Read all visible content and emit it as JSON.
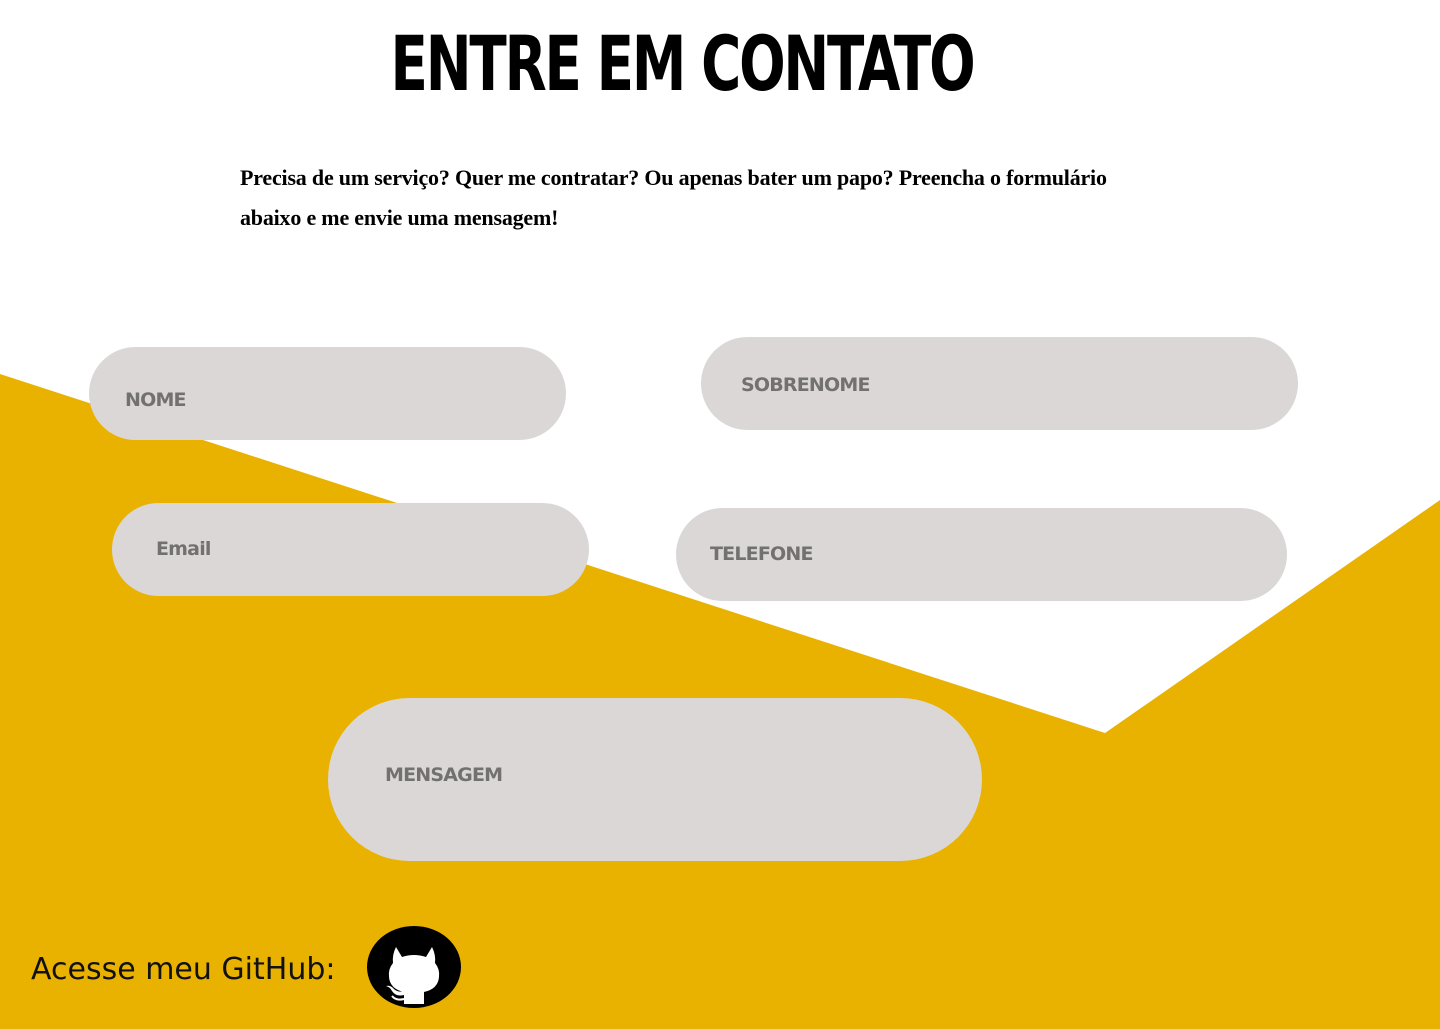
{
  "colors": {
    "background": "#ffffff",
    "accent_yellow": "#eab200",
    "field_background": "#dbd7d7",
    "field_text": "#737070",
    "heading_text": "#000000"
  },
  "header": {
    "title": "ENTRE EM CONTATO",
    "intro": "Precisa de um serviço? Quer me contratar? Ou apenas bater um papo? Preencha o formulário abaixo e me envie uma mensagem!"
  },
  "form": {
    "nome": {
      "placeholder": "NOME",
      "value": ""
    },
    "sobrenome": {
      "placeholder": "SOBRENOME",
      "value": ""
    },
    "email": {
      "placeholder": "Email",
      "value": ""
    },
    "telefone": {
      "placeholder": "TELEFONE",
      "value": ""
    },
    "mensagem": {
      "placeholder": "MENSAGEM",
      "value": ""
    }
  },
  "footer": {
    "github_label": "Acesse meu GitHub:",
    "github_icon": "github-icon"
  }
}
